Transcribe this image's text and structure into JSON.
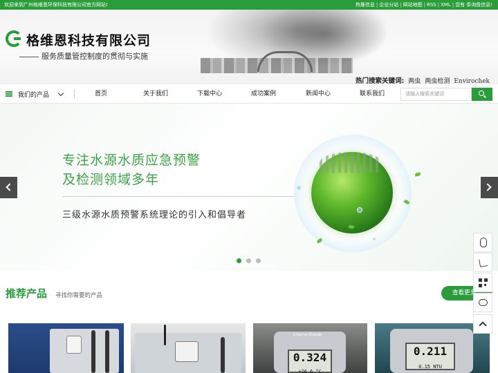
{
  "topbar": {
    "welcome": "欢迎来到广州格维恩环保科技有限公司官方网站!",
    "links": [
      "热推信息",
      "企业分站",
      "网站地图",
      "RSS",
      "XML",
      "您有",
      "条询盘信息!"
    ]
  },
  "header": {
    "company": "格维恩科技有限公司",
    "slogan": "服务质量管控制度的贯彻与实施",
    "hot_title": "热门搜索关键词:",
    "hot_keywords": [
      "两虫",
      "两虫检测",
      "Envirochek"
    ]
  },
  "nav": {
    "category_label": "我们的产品",
    "items": [
      "首页",
      "关于我们",
      "下载中心",
      "成功案例",
      "新闻中心",
      "联系我们"
    ],
    "search_placeholder": "请输入搜索关键词"
  },
  "banner": {
    "headline_line1": "专注水源水质应急预警",
    "headline_line2": "及检测领域多年",
    "subline": "三级水源水质预警系统理论的引入和倡导者",
    "slides": 3,
    "active_slide": 1
  },
  "products": {
    "title": "推荐产品",
    "subtitle": "寻找你需要的产品",
    "more_label": "查看更多",
    "items": [
      {
        "display_main": "",
        "display_sub": ""
      },
      {
        "display_main": "",
        "display_sub": ""
      },
      {
        "display_main": "0.324",
        "display_sub": "+26.6 °C",
        "brand": "Chlorine Dioxide"
      },
      {
        "display_main": "0.211",
        "display_sub": "0.15 NTU"
      }
    ]
  },
  "floating_tools": [
    "qq-icon",
    "phone-icon",
    "qrcode-icon",
    "chat-icon",
    "back-to-top-icon"
  ]
}
